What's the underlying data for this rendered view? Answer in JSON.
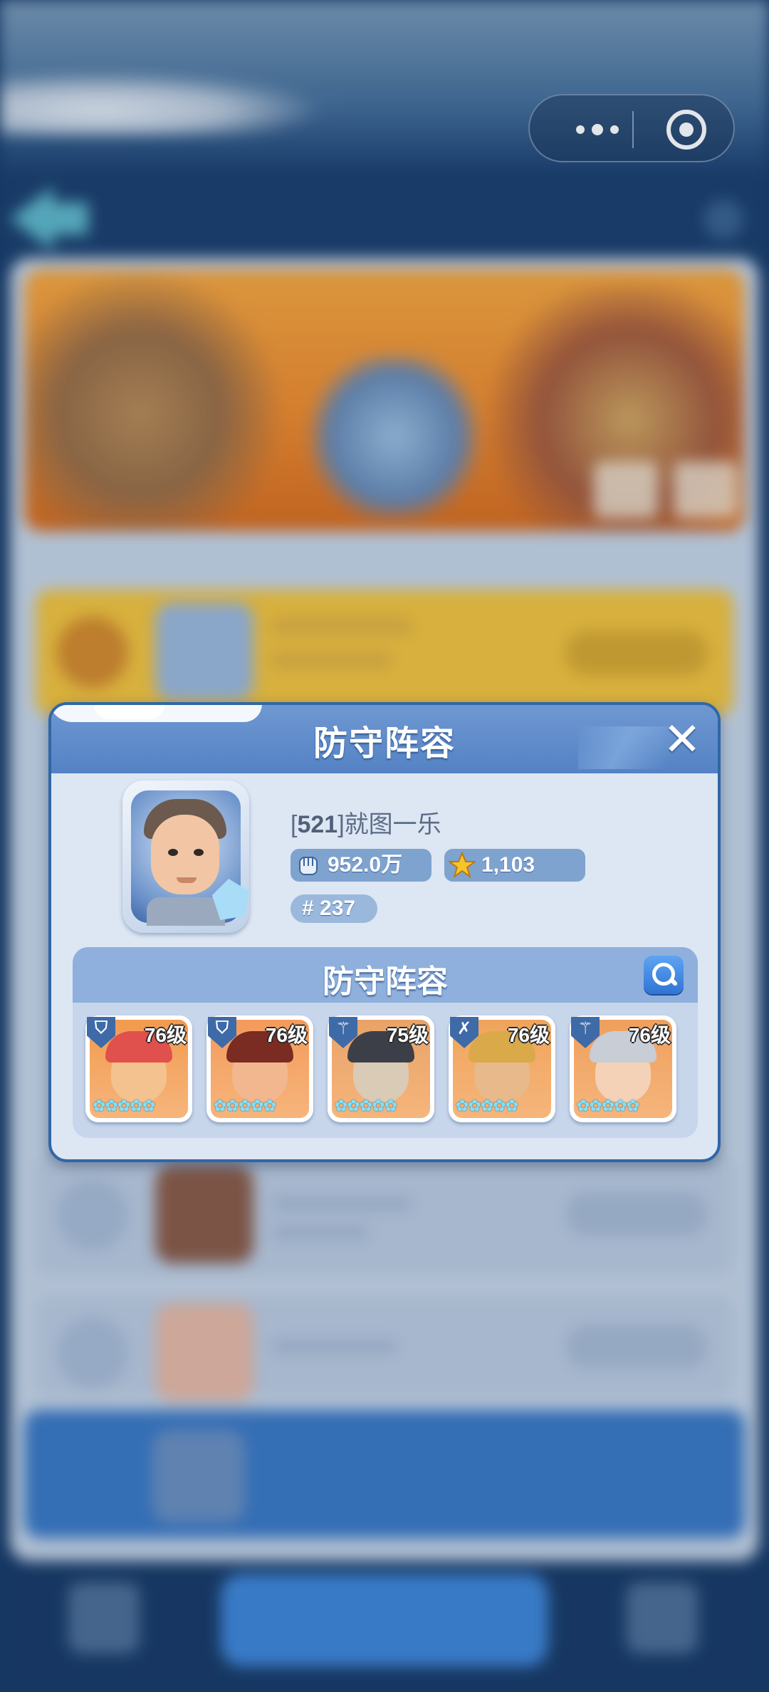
{
  "capsule": {
    "more_icon": "more-dots-icon",
    "close_icon": "mini-program-close-icon"
  },
  "dialog": {
    "title": "防守阵容",
    "close_icon": "close-icon",
    "player": {
      "guild_tag": "521",
      "name": "就图一乐",
      "power": "952.0万",
      "stars": "1,103",
      "rank": "# 237"
    },
    "lineup": {
      "title": "防守阵容",
      "search_icon": "magnifier-icon",
      "heroes": [
        {
          "level": "76级",
          "role_icon": "shield-icon",
          "stars": 5,
          "palette": {
            "bg": "#f29a4e",
            "hair": "#e0504c",
            "face": "#f4c28e"
          }
        },
        {
          "level": "76级",
          "role_icon": "shield-icon",
          "stars": 5,
          "palette": {
            "bg": "#f49a5a",
            "hair": "#7a2b22",
            "face": "#f2b78e"
          }
        },
        {
          "level": "75级",
          "role_icon": "staff-icon",
          "stars": 5,
          "palette": {
            "bg": "#e8a368",
            "hair": "#3c3f47",
            "face": "#d9cbb6"
          }
        },
        {
          "level": "76级",
          "role_icon": "crossbow-icon",
          "stars": 5,
          "palette": {
            "bg": "#f0a45a",
            "hair": "#d9a94a",
            "face": "#e8b98a"
          }
        },
        {
          "level": "76级",
          "role_icon": "staff-icon",
          "stars": 5,
          "palette": {
            "bg": "#ef9f5c",
            "hair": "#c9cdd6",
            "face": "#f3d2b8"
          }
        }
      ]
    }
  }
}
